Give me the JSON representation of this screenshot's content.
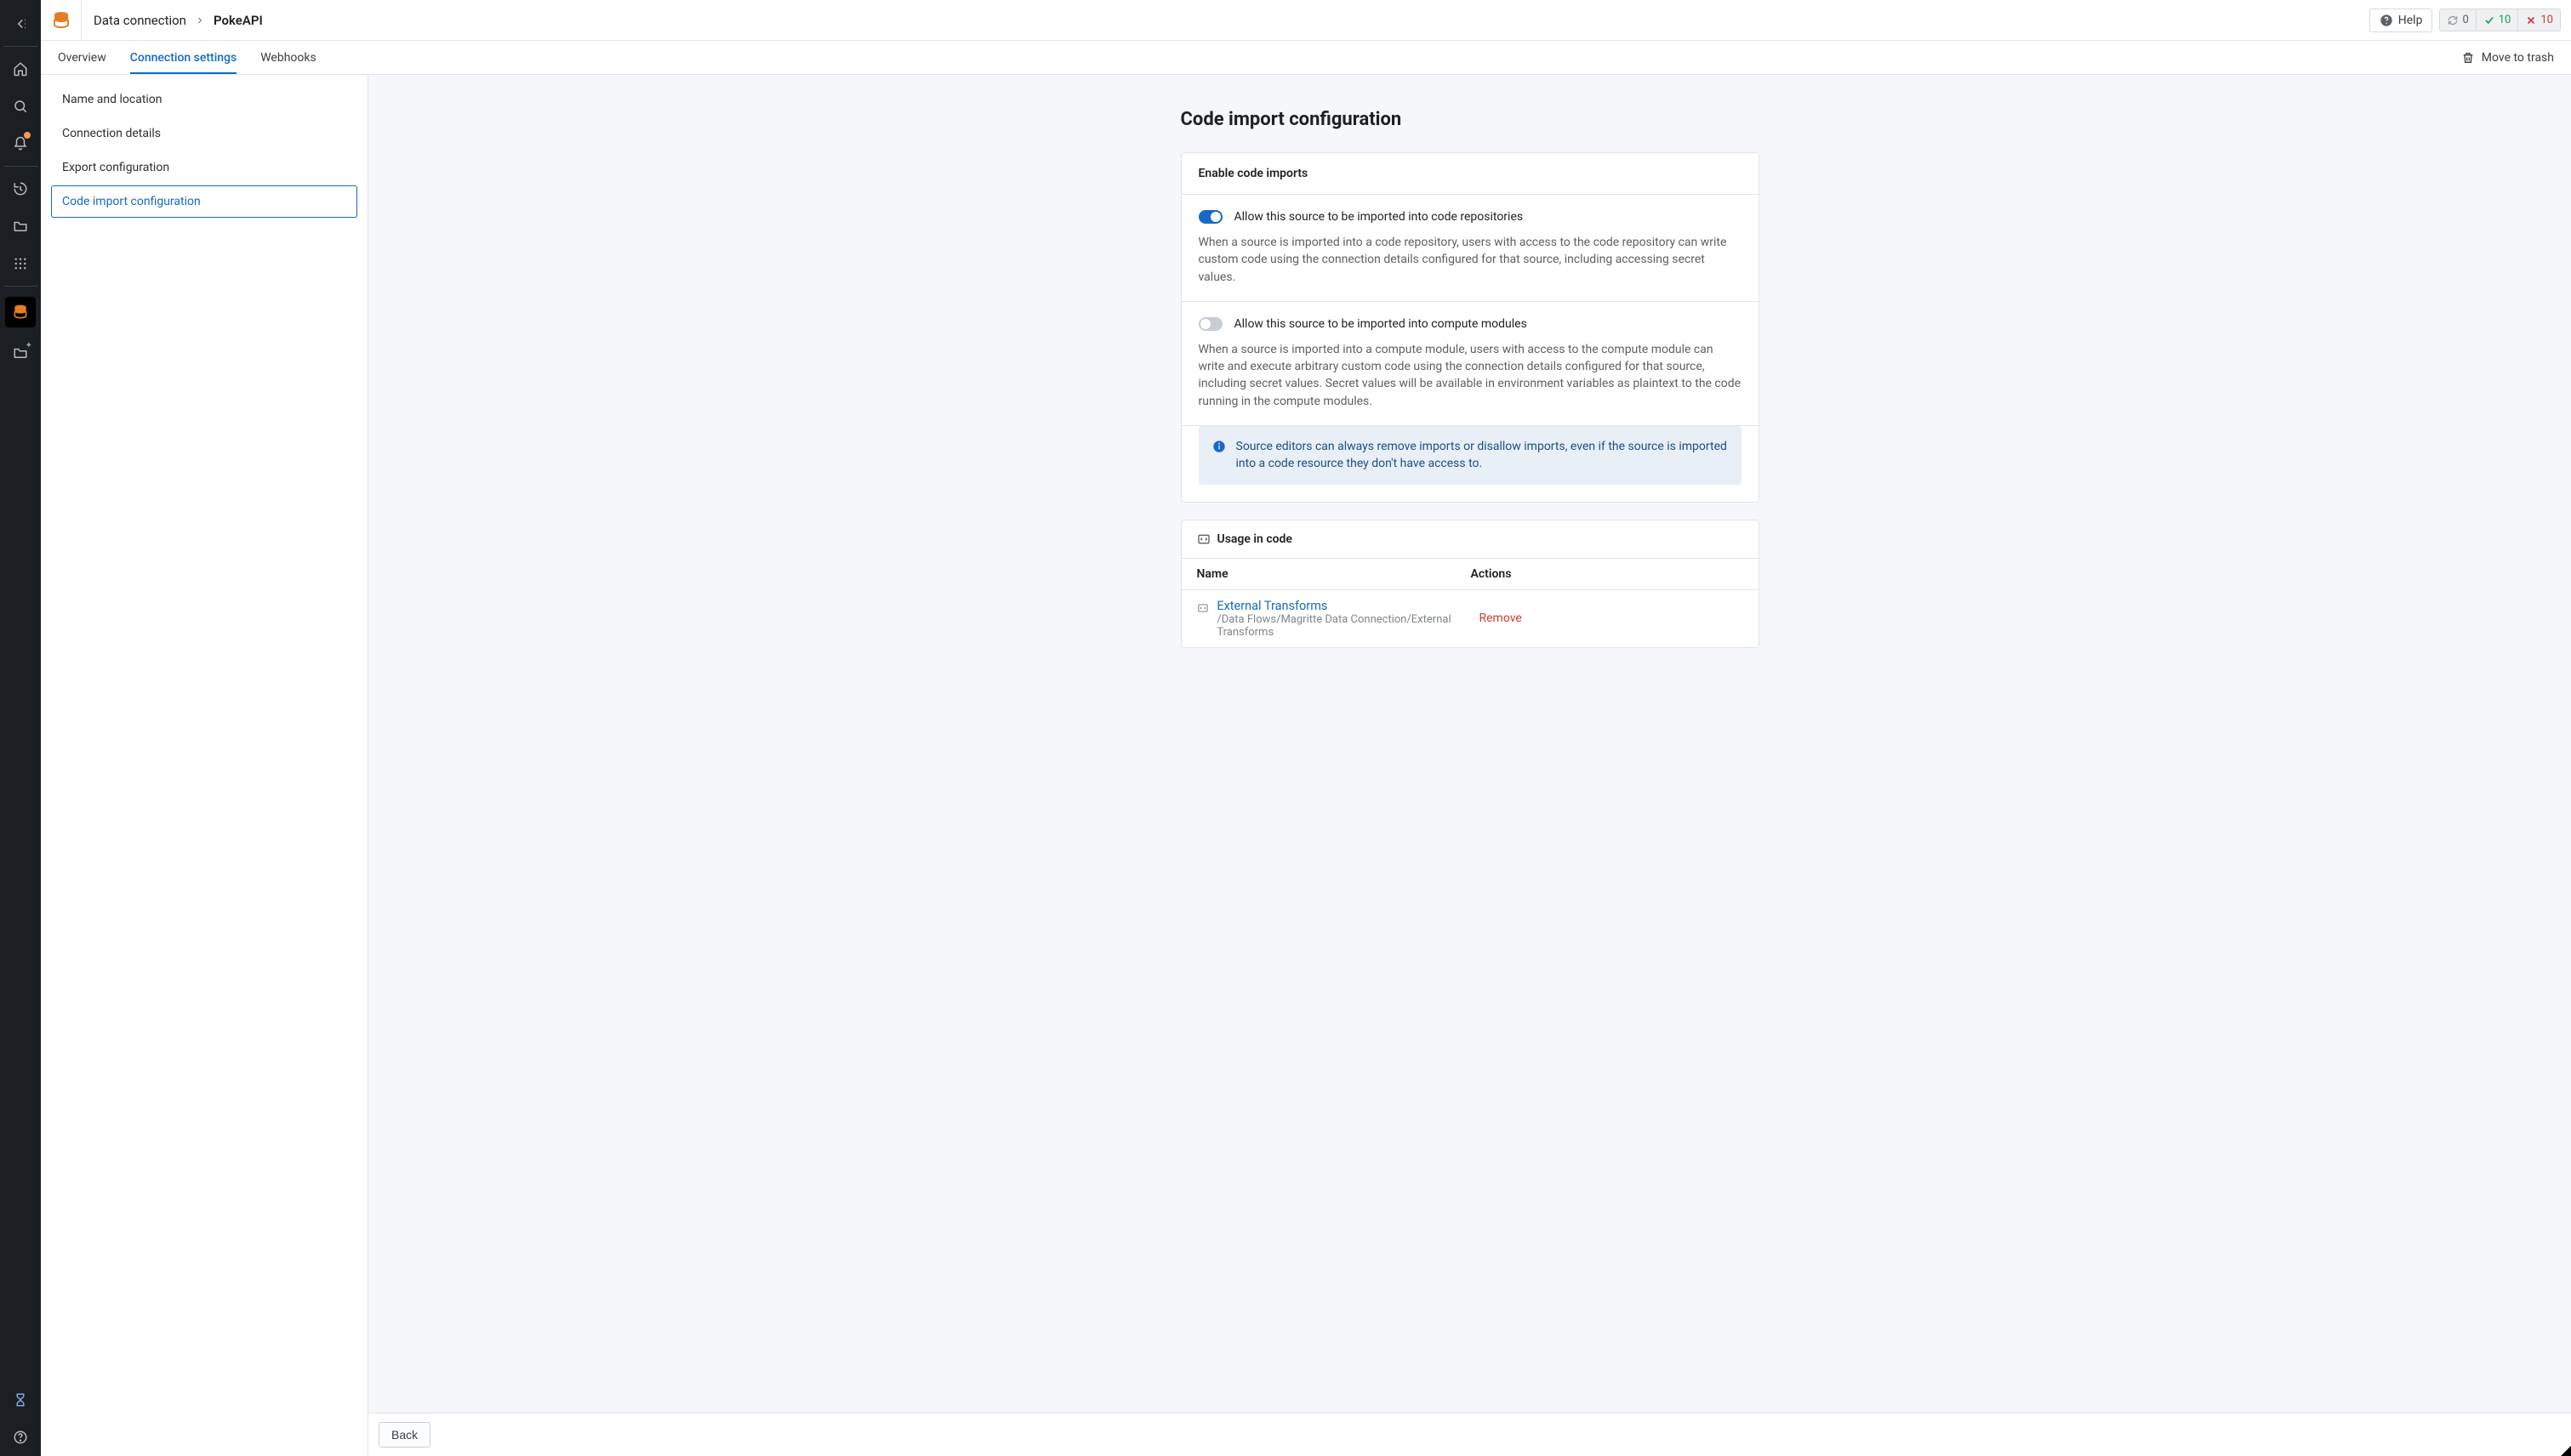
{
  "header": {
    "breadcrumb_parent": "Data connection",
    "breadcrumb_name": "PokeAPI",
    "help_label": "Help",
    "stat_sync": "0",
    "stat_ok": "10",
    "stat_err": "10"
  },
  "tabs": {
    "overview": "Overview",
    "connection_settings": "Connection settings",
    "webhooks": "Webhooks",
    "move_to_trash": "Move to trash"
  },
  "sidenav": {
    "name_location": "Name and location",
    "connection_details": "Connection details",
    "export_config": "Export configuration",
    "code_import_config": "Code import configuration"
  },
  "page": {
    "title": "Code import configuration",
    "card_header": "Enable code imports",
    "toggle1_label": "Allow this source to be imported into code repositories",
    "toggle1_desc": "When a source is imported into a code repository, users with access to the code repository can write custom code using the connection details configured for that source, including accessing secret values.",
    "toggle2_label": "Allow this source to be imported into compute modules",
    "toggle2_desc": "When a source is imported into a compute module, users with access to the compute module can write and execute arbitrary custom code using the connection details configured for that source, including secret values. Secret values will be available in environment variables as plaintext to the code running in the compute modules.",
    "callout": "Source editors can always remove imports or disallow imports, even if the source is imported into a code resource they don't have access to."
  },
  "usage": {
    "header": "Usage in code",
    "col_name": "Name",
    "col_actions": "Actions",
    "row_name": "External Transforms",
    "row_path": "/Data Flows/Magritte Data Connection/External Transforms",
    "remove": "Remove"
  },
  "footer": {
    "back": "Back"
  }
}
